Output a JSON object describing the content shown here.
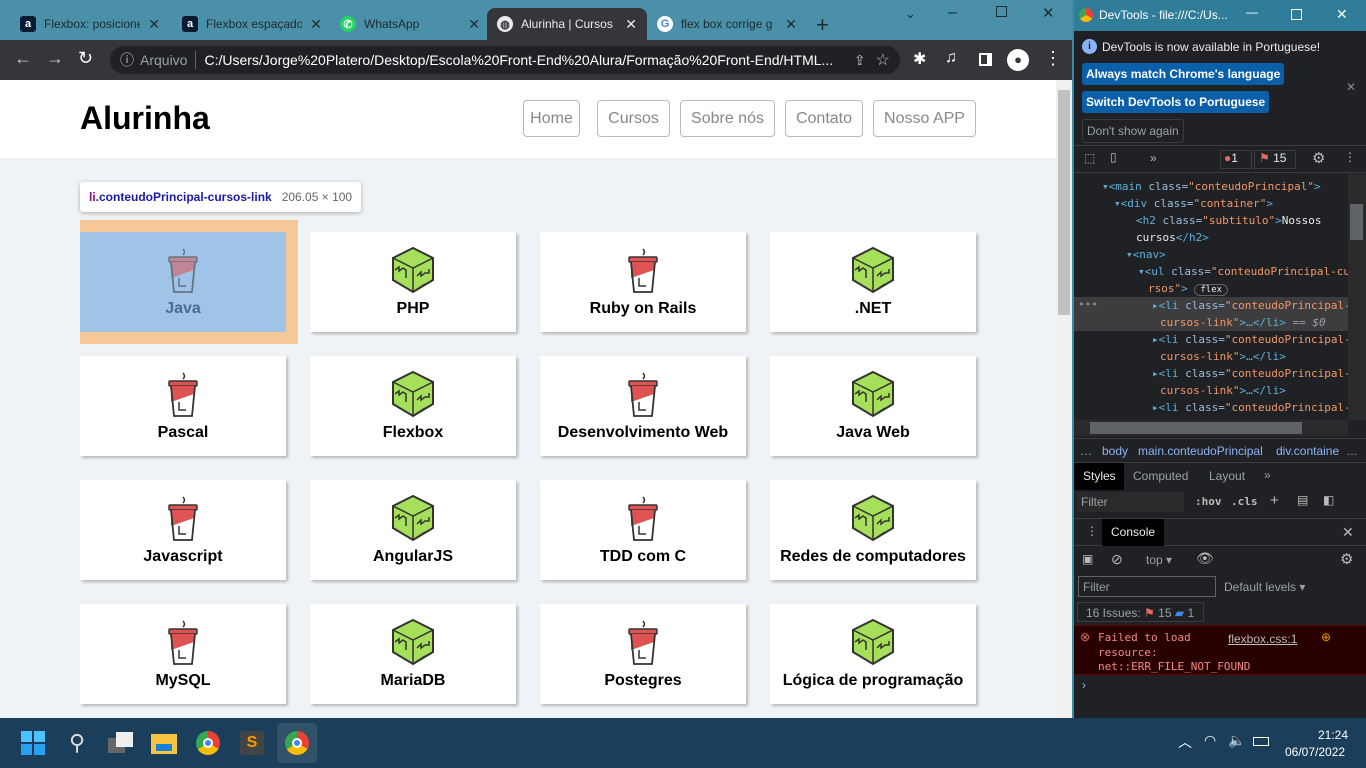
{
  "browser": {
    "tabs": [
      {
        "title": "Flexbox: posicione",
        "icon": "alura-icon"
      },
      {
        "title": "Flexbox espaçado",
        "icon": "alura-icon"
      },
      {
        "title": "WhatsApp",
        "icon": "whatsapp-icon"
      },
      {
        "title": "Alurinha | Cursos",
        "icon": "globe-icon",
        "active": true
      },
      {
        "title": "flex box corrige g",
        "icon": "google-icon"
      }
    ],
    "address_prefix": "Arquivo",
    "url": "C:/Users/Jorge%20Platero/Desktop/Escola%20Front-End%20Alura/Formação%20Front-End/HTML..."
  },
  "page": {
    "logo": "Alurinha",
    "nav": [
      "Home",
      "Cursos",
      "Sobre nós",
      "Contato",
      "Nosso APP"
    ],
    "tooltip": {
      "selector_tag": "li",
      "selector_class": ".conteudoPrincipal-cursos-link",
      "size": "206.05 × 100"
    },
    "courses": [
      {
        "name": "Java",
        "icon": "cup"
      },
      {
        "name": "PHP",
        "icon": "cube"
      },
      {
        "name": "Ruby on Rails",
        "icon": "cup"
      },
      {
        "name": ".NET",
        "icon": "cube"
      },
      {
        "name": "Pascal",
        "icon": "cup"
      },
      {
        "name": "Flexbox",
        "icon": "cube"
      },
      {
        "name": "Desenvolvimento Web",
        "icon": "cup"
      },
      {
        "name": "Java Web",
        "icon": "cube"
      },
      {
        "name": "Javascript",
        "icon": "cup"
      },
      {
        "name": "AngularJS",
        "icon": "cube"
      },
      {
        "name": "TDD com C",
        "icon": "cup"
      },
      {
        "name": "Redes de computadores",
        "icon": "cube"
      },
      {
        "name": "MySQL",
        "icon": "cup"
      },
      {
        "name": "MariaDB",
        "icon": "cube"
      },
      {
        "name": "Postegres",
        "icon": "cup"
      },
      {
        "name": "Lógica de programação",
        "icon": "cube"
      }
    ],
    "colors": {
      "cup": "#e05353",
      "cube": "#a6e05a",
      "highlight_content": "#a0c4e8",
      "highlight_margin": "#f6c897"
    }
  },
  "devtools": {
    "title": "DevTools - file:///C:/Us...",
    "banner": "DevTools is now available in Portuguese!",
    "btn_match": "Always match Chrome's language",
    "btn_switch": "Switch DevTools to Portuguese",
    "btn_dont": "Don't show again",
    "errors": "1",
    "warnings": "15",
    "breadcrumb": [
      "…",
      "body",
      "main.conteudoPrincipal",
      "div.containe",
      "…"
    ],
    "tabs": [
      "Styles",
      "Computed",
      "Layout"
    ],
    "filter": "Filter",
    "hov": ":hov",
    "cls": ".cls",
    "console_tab": "Console",
    "context": "top",
    "levels": "Default levels",
    "issues_label": "16 Issues:",
    "issues_err": "15",
    "issues_info": "1",
    "error_msg": [
      "Failed to load",
      "resource:",
      "net::ERR_FILE_NOT_FOUND"
    ],
    "error_src": "flexbox.css:1",
    "flex_badge": "flex",
    "sel_marker": "== $0"
  },
  "taskbar": {
    "time": "21:24",
    "date": "06/07/2022"
  }
}
